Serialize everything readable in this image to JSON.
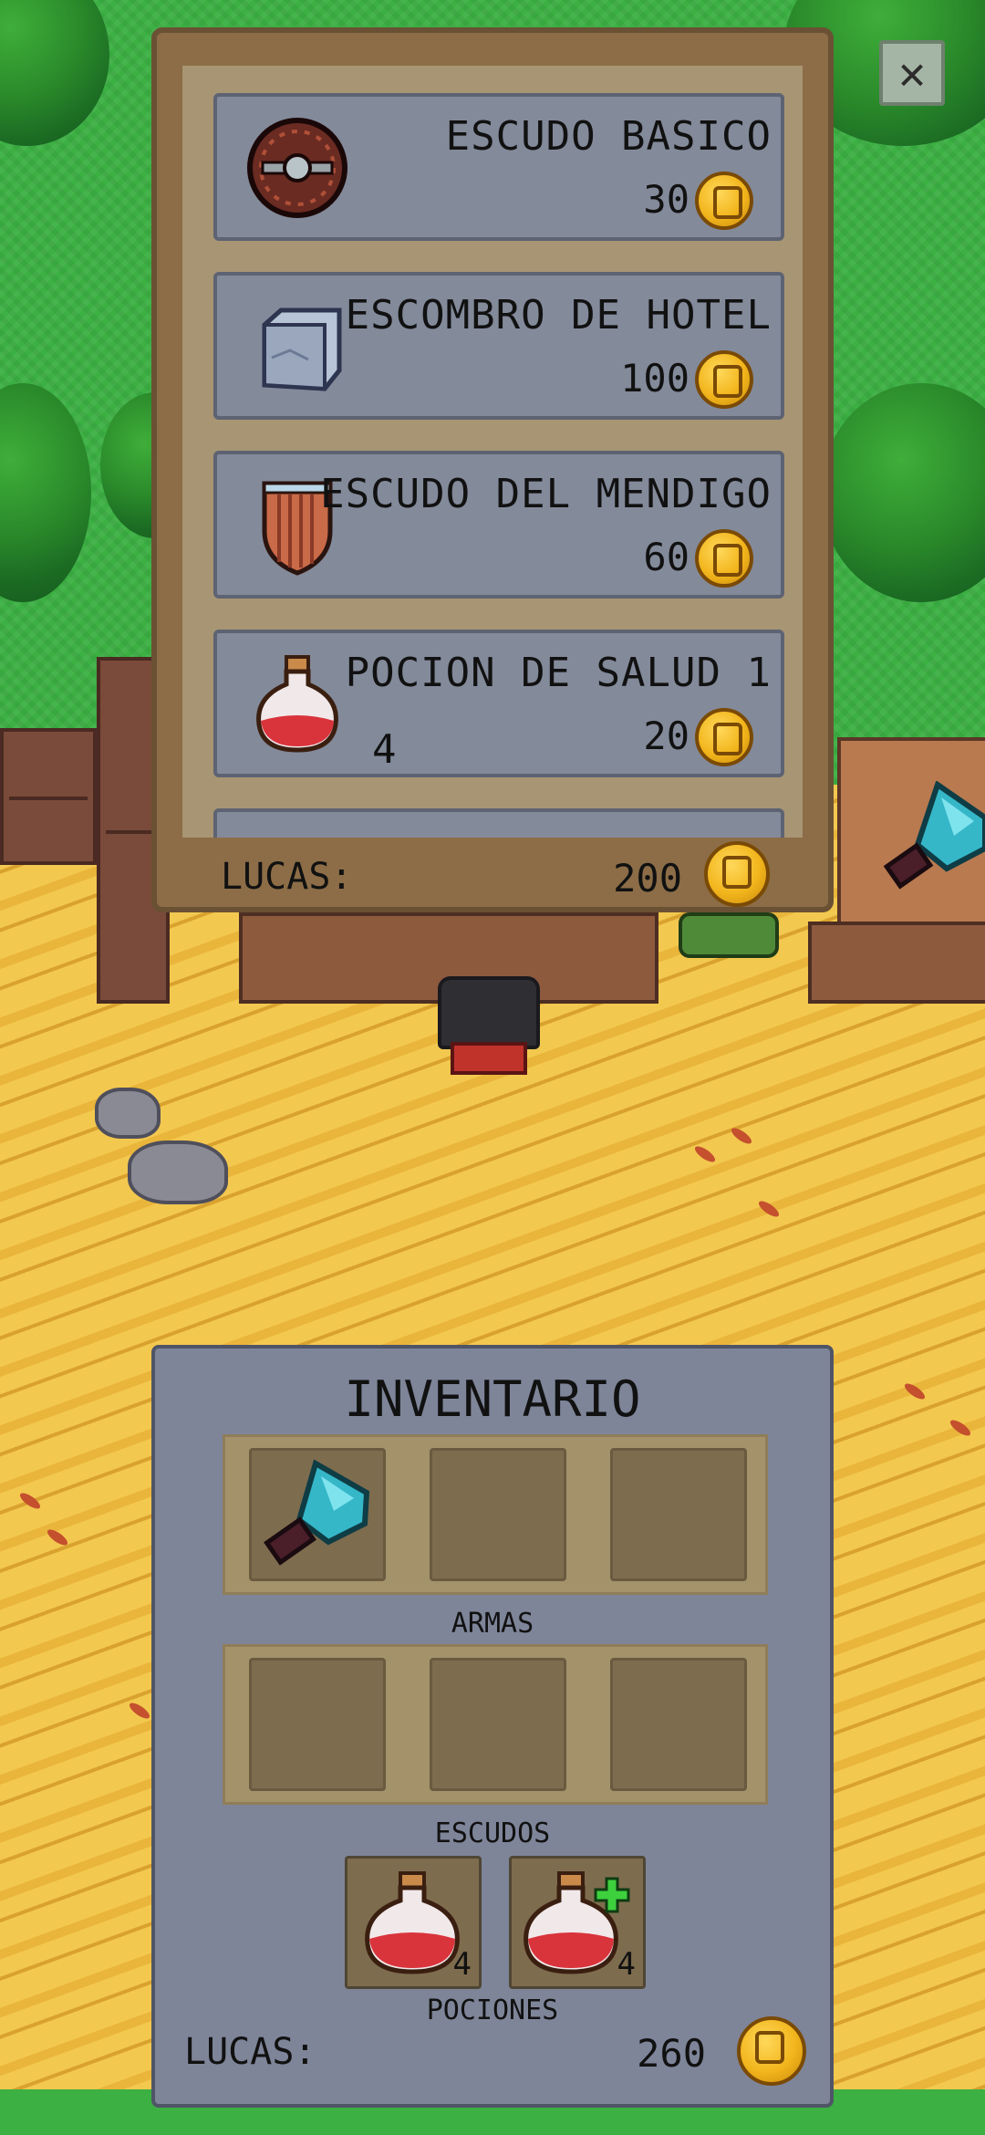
{
  "shop": {
    "items": [
      {
        "name": "ESCUDO BASICO",
        "price": "30",
        "icon": "round-shield-icon",
        "count": ""
      },
      {
        "name": "ESCOMBRO DE HOTEL",
        "price": "100",
        "icon": "stone-block-icon",
        "count": ""
      },
      {
        "name": "ESCUDO DEL MENDIGO",
        "price": "60",
        "icon": "wooden-shield-icon",
        "count": ""
      },
      {
        "name": "POCION DE SALUD 1",
        "price": "20",
        "icon": "health-potion-icon",
        "count": "4"
      }
    ],
    "currency_label": "LUCAS:",
    "currency_amount": "200",
    "close_icon": "close-icon"
  },
  "inventory": {
    "title": "INVENTARIO",
    "weapons_label": "ARMAS",
    "shields_label": "ESCUDOS",
    "potions_label": "POCIONES",
    "weapon_slots": [
      "blue-blade-weapon-icon",
      "",
      ""
    ],
    "shield_slots": [
      "",
      "",
      ""
    ],
    "potions": [
      {
        "icon": "health-potion-icon",
        "count": "4"
      },
      {
        "icon": "health-potion-plus-icon",
        "count": "4"
      }
    ],
    "currency_label": "LUCAS:",
    "currency_amount": "260"
  },
  "colors": {
    "grass": "#3cb043",
    "sand": "#f3c84f",
    "panel_wood": "#8c6d47",
    "item_card": "#838a9a",
    "inventory_panel": "#7e8599",
    "coin": "#f2b51c"
  }
}
